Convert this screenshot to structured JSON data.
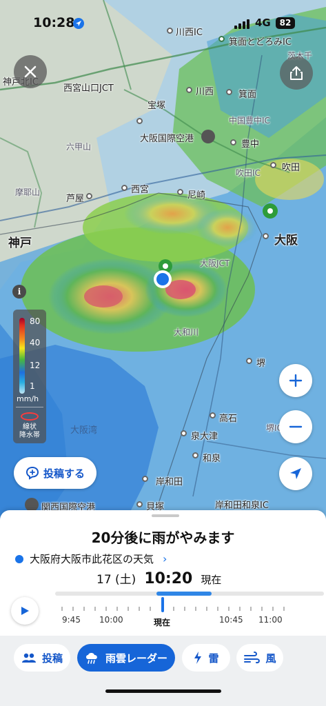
{
  "status_bar": {
    "time": "10:28",
    "network": "4G",
    "battery": "82"
  },
  "map": {
    "labels": {
      "kawanishi_ic": "川西IC",
      "mino_tokoro_ic": "箕面とどろみIC",
      "ibaraki_ic": "茨木千",
      "kobe_kita_ic": "神戸北IC",
      "nishinomiya_yamaguchi_jct": "西宮山口JCT",
      "kawanishi": "川西",
      "minoh": "箕面",
      "takarazuka": "宝塚",
      "chugoku_toyonaka_ic": "中国豊中IC",
      "rokkosan": "六甲山",
      "osaka_airport": "大阪国際空港",
      "toyonaka": "豊中",
      "suita_ic": "吹田IC",
      "suita": "吹田",
      "mayasan": "摩耶山",
      "nishinomiya": "西宮",
      "ashiya": "芦屋",
      "amagasaki": "尼崎",
      "kobe": "神戸",
      "osaka": "大阪",
      "osaka_jct": "大阪JCT",
      "sakai": "堺",
      "osaka_bay": "大阪湾",
      "takaishi": "高石",
      "izumiotsu": "泉大津",
      "sakai_ic": "堺IC",
      "izumi": "和泉",
      "kishiwada": "岸和田",
      "kishiwada_izumi_ic": "岸和田和泉IC",
      "kaizuka": "貝塚",
      "kix": "関西国際空港",
      "yamato_river": "大和川"
    }
  },
  "legend": {
    "levels": [
      "80",
      "40",
      "12",
      "1"
    ],
    "unit": "mm/h",
    "band_label_1": "線状",
    "band_label_2": "降水帯"
  },
  "post_button": {
    "label": "投稿する"
  },
  "sheet": {
    "headline": "20分後に雨がやみます",
    "place": "大阪府大阪市此花区の天気",
    "date": "17 (土)",
    "time": "10:20",
    "now_label": "現在",
    "timeline_labels": [
      "9:45",
      "10:00",
      "現在",
      "10:45",
      "11:00"
    ]
  },
  "tabs": [
    {
      "label": "投稿",
      "icon": "people-icon"
    },
    {
      "label": "雨雲レーダー",
      "icon": "rain-cloud-icon"
    },
    {
      "label": "雷",
      "icon": "lightning-icon"
    },
    {
      "label": "風",
      "icon": "wind-icon"
    }
  ],
  "colors": {
    "accent": "#1665d8",
    "rain_light": "#2f86e6",
    "rain_heavy": "#e03020"
  }
}
